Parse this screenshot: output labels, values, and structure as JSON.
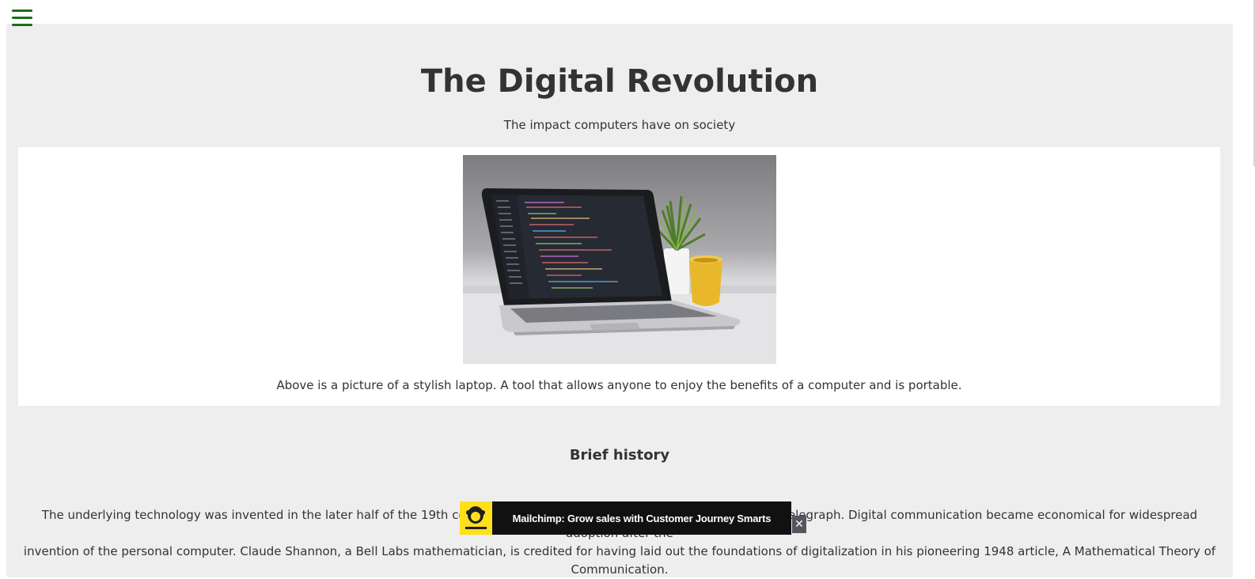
{
  "nav": {
    "menu_icon": "hamburger-menu-icon",
    "menu_color": "#1f6b1a"
  },
  "header": {
    "title": "The Digital Revolution",
    "subtitle": "The impact computers have on society"
  },
  "figure": {
    "image_icon": "laptop-photo",
    "caption": "Above is a picture of a stylish laptop. A tool that allows anyone to enjoy the benefits of a computer and is portable."
  },
  "history": {
    "heading": "Brief history",
    "paragraph_line1": "The underlying technology was invented in the later half of the 19th century, including Babbage's analytical engine and the telegraph. Digital communication became economical for widespread adoption after the",
    "paragraph_line2": "invention of the personal computer. Claude Shannon, a Bell Labs mathematician, is credited for having laid out the foundations of digitalization in his pioneering 1948 article, A Mathematical Theory of Communication."
  },
  "ad": {
    "brand": "mailchimp",
    "text": "Mailchimp: Grow sales with Customer Journey Smarts",
    "close_label": "✕",
    "brand_color": "#ffe01b"
  },
  "colors": {
    "page_bg": "#eeeeee",
    "card_bg": "#ffffff",
    "text": "#333333"
  }
}
